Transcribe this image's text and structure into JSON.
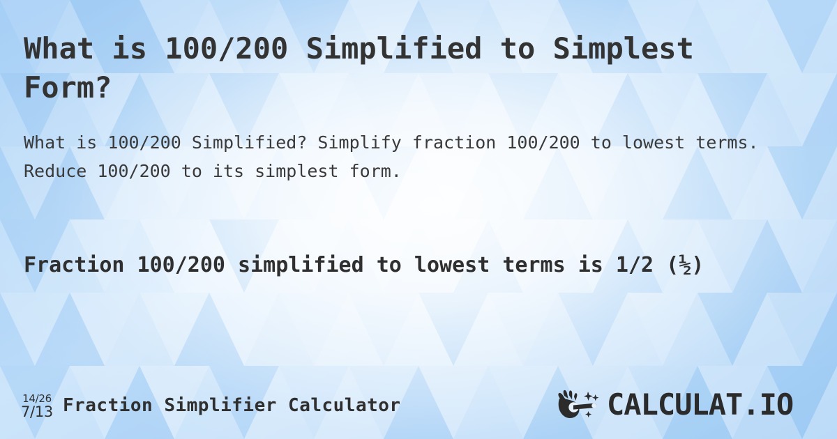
{
  "page": {
    "title": "What is 100/200 Simplified to Simplest Form?",
    "subtitle": "What is 100/200 Simplified? Simplify fraction 100/200 to lowest terms. Reduce 100/200 to its simplest form.",
    "result": "Fraction 100/200 simplified to lowest terms is 1/2 (½)"
  },
  "fraction": {
    "numerator": "100",
    "denominator": "200",
    "simplified": "1/2",
    "simplified_vulgar": "½"
  },
  "footer": {
    "icon": {
      "name": "fraction-reduce-icon",
      "top": "14/26",
      "bottom": "7/13"
    },
    "tool_name": "Fraction Simplifier Calculator",
    "brand": {
      "logo_icon": "magic-wand-hand-icon",
      "wordmark": "CALCULAT.IO"
    }
  },
  "colors": {
    "background_edge": "#9ccbf6",
    "background_center": "#eef7fe",
    "text_primary": "#333333",
    "text_secondary": "#3a3a3a",
    "brand_dark": "#2b2b2b"
  }
}
